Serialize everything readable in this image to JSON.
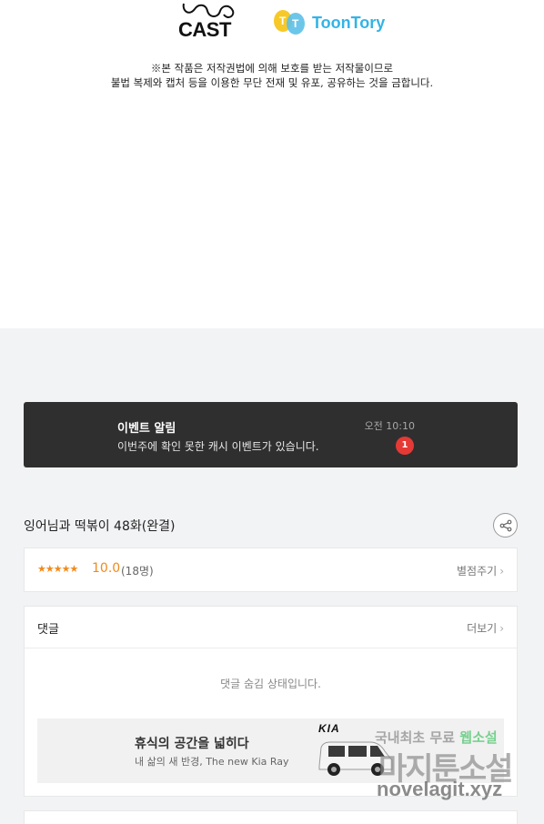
{
  "header": {
    "cast_logo_text": "CAST",
    "toontory_logo_text": "ToonTory",
    "notice_line1": "※본 작품은 저작권법에 의해 보호를 받는 저작물이므로",
    "notice_line2": "불법 복제와 캡처 등을 이용한 무단 전재 및 유포, 공유하는 것을 금합니다."
  },
  "event": {
    "title": "이벤트 알림",
    "description": "이번주에 확인 못한 캐시 이벤트가 있습니다.",
    "time": "오전 10:10",
    "badge_count": "1"
  },
  "episode": {
    "title": "잉어님과 떡볶이 48화(완결)"
  },
  "rating": {
    "stars": "★★★★★",
    "score": "10.0",
    "count": "(18명)",
    "rate_link": "별점주기"
  },
  "comments": {
    "label": "댓글",
    "more": "더보기",
    "hidden_message": "댓글 숨김 상태입니다."
  },
  "ad": {
    "headline": "휴식의 공간을 넓히다",
    "subline": "내 삶의 새 반경, The new Kia Ray",
    "brand": "KIA"
  },
  "watermark": {
    "line1_prefix": "국내최초 무료",
    "line1_highlight": "웹소설",
    "line2": "마지툰소설",
    "line3": "novelagit.xyz"
  },
  "colors": {
    "accent_orange": "#f08a1c",
    "badge_red": "#e53935",
    "event_bg": "#2f2f2f",
    "toontory_blue": "#33b3e6"
  }
}
